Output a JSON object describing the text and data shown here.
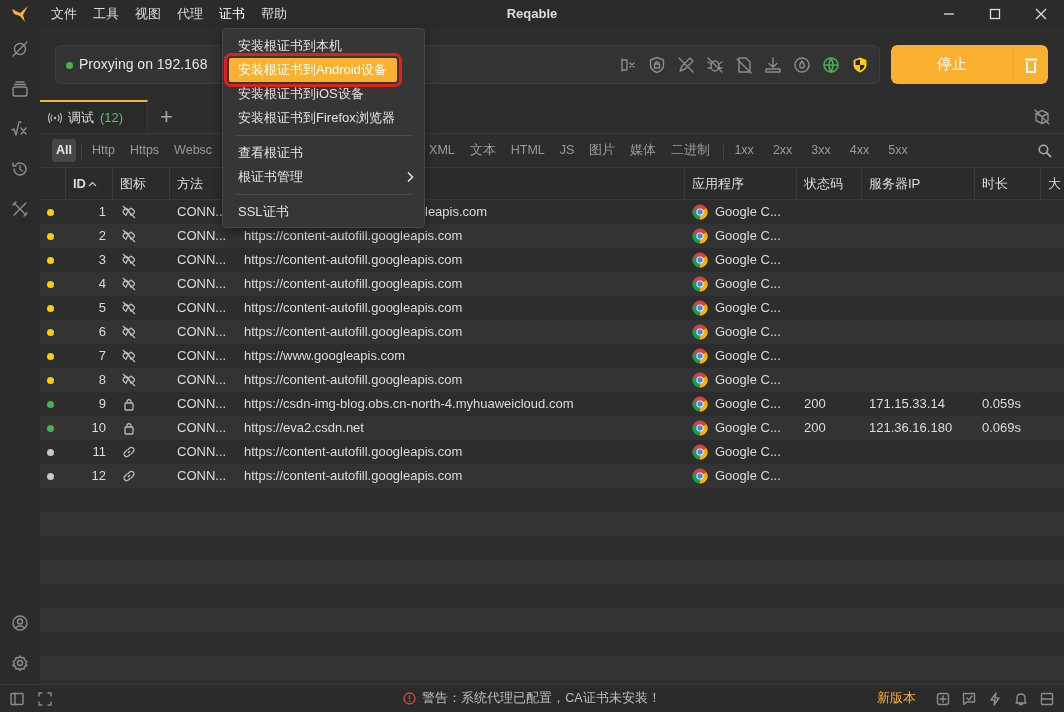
{
  "title": "Reqable",
  "menubar": [
    {
      "label": "文件",
      "open": false
    },
    {
      "label": "工具",
      "open": false
    },
    {
      "label": "视图",
      "open": false
    },
    {
      "label": "代理",
      "open": false
    },
    {
      "label": "证书",
      "open": true
    },
    {
      "label": "帮助",
      "open": false
    }
  ],
  "proxy": {
    "status": "Proxying on 192.168",
    "running": true
  },
  "stop_button": "停止",
  "tabs": [
    {
      "label": "调试",
      "count": "(12)",
      "selected": true
    }
  ],
  "add_tab": "+",
  "filters": [
    {
      "label": "All",
      "selected": true
    },
    {
      "label": "Http",
      "selected": false
    },
    {
      "label": "Https",
      "selected": false
    },
    {
      "label": "Websc",
      "selected": false,
      "covered_after": true
    },
    {
      "label": "XML",
      "selected": false
    },
    {
      "label": "文本",
      "selected": false
    },
    {
      "label": "HTML",
      "selected": false
    },
    {
      "label": "JS",
      "selected": false
    },
    {
      "label": "图片",
      "selected": false
    },
    {
      "label": "媒体",
      "selected": false
    },
    {
      "label": "二进制",
      "selected": false
    }
  ],
  "status_filters": [
    "1xx",
    "2xx",
    "3xx",
    "4xx",
    "5xx"
  ],
  "columns": [
    {
      "label": "ID",
      "sorted": true
    },
    {
      "label": "图标",
      "sorted": false
    },
    {
      "label": "方法",
      "sorted": false
    },
    {
      "label": "应用程序",
      "sorted": false
    },
    {
      "label": "状态码",
      "sorted": false
    },
    {
      "label": "服务器IP",
      "sorted": false
    },
    {
      "label": "时长",
      "sorted": false
    },
    {
      "label": "大",
      "sorted": false
    }
  ],
  "rows": [
    {
      "color": "#ffd000",
      "id": "1",
      "kind": "unlinked",
      "method": "CONN..",
      "url": "leapis.com",
      "url_covered": true,
      "app": "Google C..."
    },
    {
      "color": "#ffd000",
      "id": "2",
      "kind": "unlinked",
      "method": "CONN...",
      "url": "https://content-autofill.googleapis.com",
      "app": "Google C..."
    },
    {
      "color": "#ffd000",
      "id": "3",
      "kind": "unlinked",
      "method": "CONN...",
      "url": "https://content-autofill.googleapis.com",
      "app": "Google C..."
    },
    {
      "color": "#ffd000",
      "id": "4",
      "kind": "unlinked",
      "method": "CONN...",
      "url": "https://content-autofill.googleapis.com",
      "app": "Google C..."
    },
    {
      "color": "#ffd000",
      "id": "5",
      "kind": "unlinked",
      "method": "CONN...",
      "url": "https://content-autofill.googleapis.com",
      "app": "Google C..."
    },
    {
      "color": "#ffd000",
      "id": "6",
      "kind": "unlinked",
      "method": "CONN...",
      "url": "https://content-autofill.googleapis.com",
      "app": "Google C..."
    },
    {
      "color": "#ffd000",
      "id": "7",
      "kind": "unlinked",
      "method": "CONN...",
      "url": "https://www.googleapis.com",
      "app": "Google C..."
    },
    {
      "color": "#ffd000",
      "id": "8",
      "kind": "unlinked",
      "method": "CONN...",
      "url": "https://content-autofill.googleapis.com",
      "app": "Google C..."
    },
    {
      "color": "#4caf50",
      "id": "9",
      "kind": "secure",
      "method": "CONN...",
      "url": "https://csdn-img-blog.obs.cn-north-4.myhuaweicloud.com",
      "app": "Google C...",
      "status": "200",
      "server_ip": "171.15.33.14",
      "duration": "0.059s"
    },
    {
      "color": "#4caf50",
      "id": "10",
      "kind": "secure",
      "method": "CONN...",
      "url": "https://eva2.csdn.net",
      "app": "Google C...",
      "status": "200",
      "server_ip": "121.36.16.180",
      "duration": "0.069s"
    },
    {
      "color": "#c8c8c8",
      "id": "11",
      "kind": "linked",
      "method": "CONN...",
      "url": "https://content-autofill.googleapis.com",
      "app": "Google C..."
    },
    {
      "color": "#c8c8c8",
      "id": "12",
      "kind": "linked",
      "method": "CONN...",
      "url": "https://content-autofill.googleapis.com",
      "app": "Google C..."
    }
  ],
  "menu": {
    "items": [
      {
        "kind": "item",
        "label": "安装根证书到本机",
        "selected": false
      },
      {
        "kind": "item",
        "label": "安装根证书到Android设备",
        "selected": true,
        "annotated": true
      },
      {
        "kind": "item",
        "label": "安装根证书到iOS设备",
        "selected": false
      },
      {
        "kind": "item",
        "label": "安装根证书到Firefox浏览器",
        "selected": false
      },
      {
        "kind": "divider"
      },
      {
        "kind": "item",
        "label": "查看根证书",
        "selected": false
      },
      {
        "kind": "submenu",
        "label": "根证书管理",
        "selected": false
      },
      {
        "kind": "divider"
      },
      {
        "kind": "item",
        "label": "SSL证书",
        "selected": false
      }
    ]
  },
  "status_bar": {
    "warning": "警告：系统代理已配置，CA证书未安装！",
    "update": "新版本"
  }
}
